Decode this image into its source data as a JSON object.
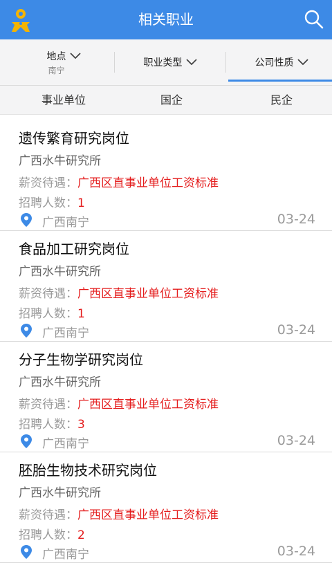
{
  "header": {
    "title": "相关职业"
  },
  "filters": {
    "location": {
      "label": "地点",
      "value": "南宁"
    },
    "job_type": {
      "label": "职业类型"
    },
    "company_type": {
      "label": "公司性质",
      "active": true
    }
  },
  "subtabs": [
    "事业单位",
    "国企",
    "民企"
  ],
  "jobs": [
    {
      "title": "遗传繁育研究岗位",
      "company": "广西水牛研究所",
      "salary_label": "薪资待遇：",
      "salary": "广西区直事业单位工资标准",
      "count_label": "招聘人数：",
      "count": "1",
      "location": "广西南宁",
      "date": "03-24"
    },
    {
      "title": "食品加工研究岗位",
      "company": "广西水牛研究所",
      "salary_label": "薪资待遇：",
      "salary": "广西区直事业单位工资标准",
      "count_label": "招聘人数：",
      "count": "1",
      "location": "广西南宁",
      "date": "03-24"
    },
    {
      "title": "分子生物学研究岗位",
      "company": "广西水牛研究所",
      "salary_label": "薪资待遇：",
      "salary": "广西区直事业单位工资标准",
      "count_label": "招聘人数：",
      "count": "3",
      "location": "广西南宁",
      "date": "03-24"
    },
    {
      "title": "胚胎生物技术研究岗位",
      "company": "广西水牛研究所",
      "salary_label": "薪资待遇：",
      "salary": "广西区直事业单位工资标准",
      "count_label": "招聘人数：",
      "count": "2",
      "location": "广西南宁",
      "date": "03-24"
    }
  ],
  "colors": {
    "accent": "#3d8ae6",
    "logo": "#f5b400",
    "highlight": "#e41c1c"
  },
  "icons": {
    "logo": "person-logo-icon",
    "search": "search-icon",
    "dropdown": "chevron-down-icon",
    "location": "location-pin-icon"
  }
}
